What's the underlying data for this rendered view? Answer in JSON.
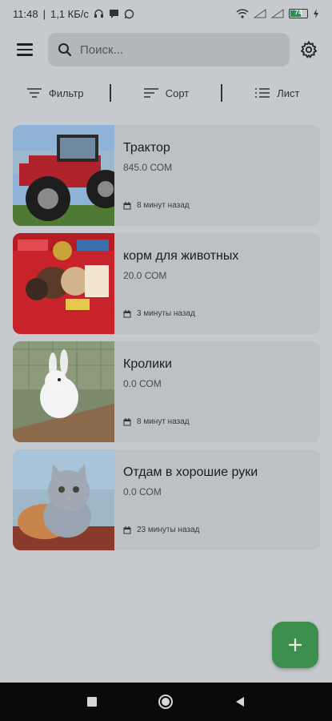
{
  "status": {
    "time": "11:48",
    "speed": "1,1 КБ/с",
    "battery": "74"
  },
  "search": {
    "placeholder": "Поиск..."
  },
  "filters": {
    "filter": "Фильтр",
    "sort": "Сорт",
    "list": "Лист"
  },
  "listings": [
    {
      "title": "Трактор",
      "price": "845.0 СОМ",
      "time": "8 минут назад",
      "image": "tractor"
    },
    {
      "title": "корм для животных",
      "price": "20.0 СОМ",
      "time": "3 минуты назад",
      "image": "animal-feed"
    },
    {
      "title": "Кролики",
      "price": "0.0 СОМ",
      "time": "8 минут назад",
      "image": "rabbit"
    },
    {
      "title": "Отдам в хорошие руки",
      "price": "0.0 СОМ",
      "time": "23 минуты назад",
      "image": "kitten"
    }
  ],
  "colors": {
    "fab": "#3c8f4c",
    "background": "#c6c9ce",
    "card": "#bdc0c5"
  }
}
